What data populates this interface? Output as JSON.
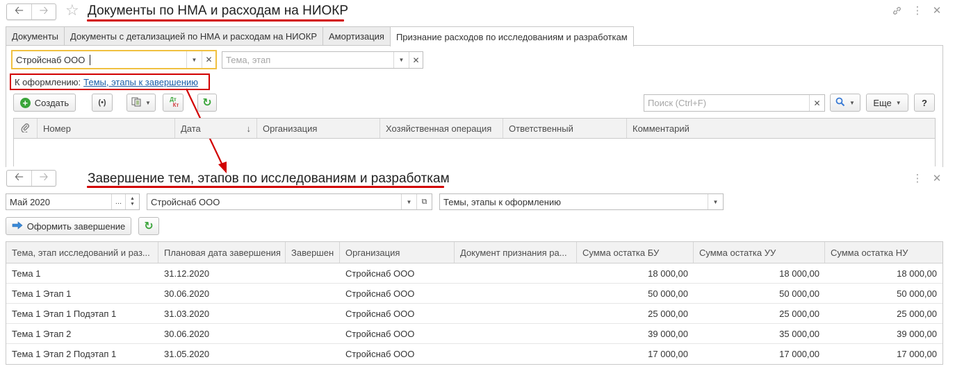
{
  "top_window": {
    "title": "Документы по НМА и расходам на НИОКР",
    "tabs": [
      {
        "label": "Документы"
      },
      {
        "label": "Документы с детализацией по НМА и расходам на НИОКР"
      },
      {
        "label": "Амортизация"
      },
      {
        "label": "Признание расходов по исследованиям и разработкам"
      }
    ],
    "org_field": {
      "value": "Стройснаб ООО"
    },
    "topic_field": {
      "placeholder": "Тема, этап"
    },
    "to_process": {
      "label": "К оформлению:",
      "link": "Темы, этапы к завершению"
    },
    "toolbar": {
      "create_label": "Создать",
      "dtkt_top": "Дт",
      "dtkt_bottom": "Кт",
      "search_placeholder": "Поиск (Ctrl+F)",
      "more_label": "Еще",
      "help_label": "?"
    },
    "columns": [
      "Номер",
      "Дата",
      "Организация",
      "Хозяйственная операция",
      "Ответственный",
      "Комментарий"
    ]
  },
  "bottom_window": {
    "title": "Завершение тем, этапов по исследованиям и разработкам",
    "period": "Май 2020",
    "period_btn": "...",
    "organization": "Стройснаб ООО",
    "filter": "Темы, этапы к оформлению",
    "complete_button": "Оформить завершение",
    "columns": [
      "Тема, этап исследований и раз...",
      "Плановая дата завершения",
      "Завершен",
      "Организация",
      "Документ признания ра...",
      "Сумма остатка БУ",
      "Сумма остатка УУ",
      "Сумма остатка НУ"
    ],
    "rows": [
      [
        "Тема 1",
        "31.12.2020",
        "",
        "Стройснаб ООО",
        "",
        "18 000,00",
        "18 000,00",
        "18 000,00"
      ],
      [
        "Тема 1 Этап 1",
        "30.06.2020",
        "",
        "Стройснаб ООО",
        "",
        "50 000,00",
        "50 000,00",
        "50 000,00"
      ],
      [
        "Тема 1 Этап 1 Подэтап 1",
        "31.03.2020",
        "",
        "Стройснаб ООО",
        "",
        "25 000,00",
        "25 000,00",
        "25 000,00"
      ],
      [
        "Тема 1 Этап 2",
        "30.06.2020",
        "",
        "Стройснаб ООО",
        "",
        "39 000,00",
        "35 000,00",
        "39 000,00"
      ],
      [
        "Тема 1 Этап 2 Подэтап 1",
        "31.05.2020",
        "",
        "Стройснаб ООО",
        "",
        "17 000,00",
        "17 000,00",
        "17 000,00"
      ]
    ]
  },
  "colors": {
    "annotation_red": "#d20000",
    "accent_yellow": "#f0c040",
    "link_blue": "#1a5ea8",
    "green_icon": "#3aa53a",
    "blue_arrow": "#3a7bd5"
  },
  "icons": [
    "back-arrow",
    "forward-arrow",
    "star",
    "link",
    "kebab",
    "close",
    "plus-circle",
    "radio-waves",
    "copy-doc",
    "refresh",
    "search",
    "paperclip",
    "sort-down",
    "right-arrow"
  ]
}
